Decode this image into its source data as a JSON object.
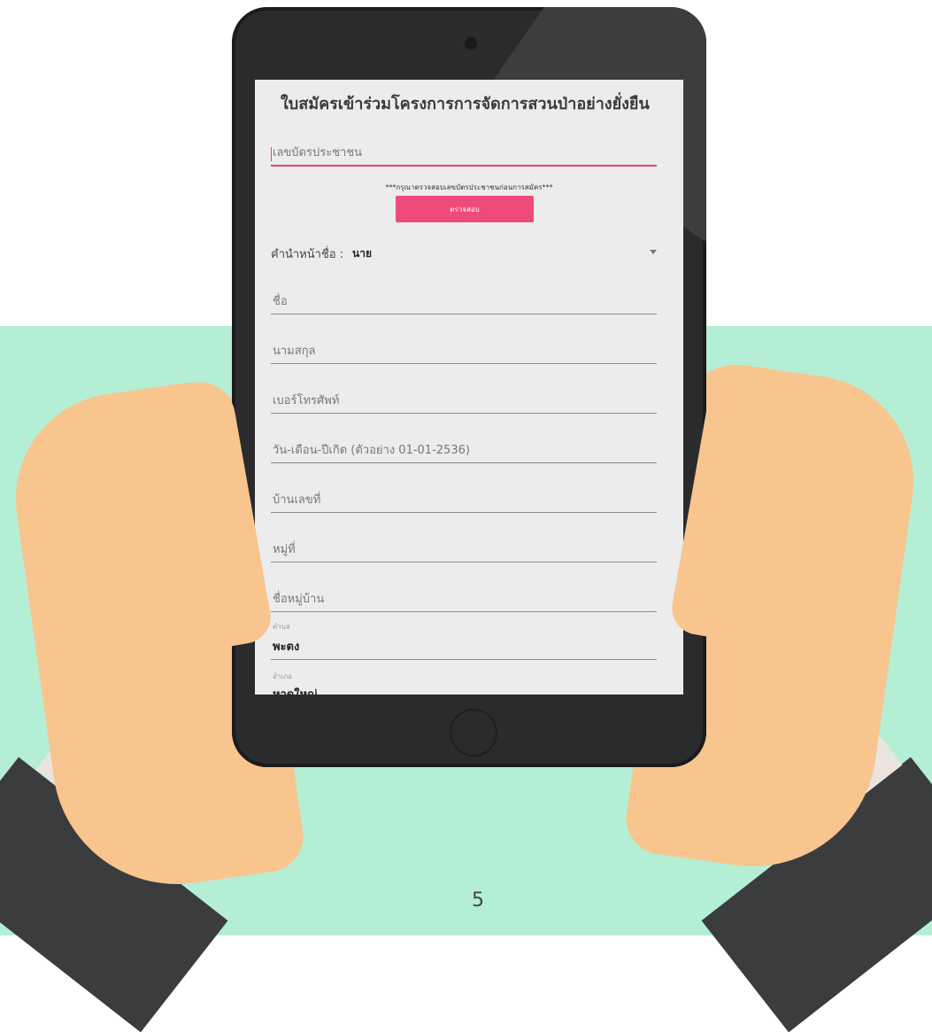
{
  "form": {
    "title": "ใบสมัครเข้าร่วมโครงการการจัดการสวนป่าอย่างยั่งยืน",
    "id_field": {
      "placeholder": "เลขบัตรประชาชน"
    },
    "notice": "***กรุณาตรวจสอบเลขบัตรประชาชนก่อนการสมัคร***",
    "check_button": "ตรวจสอบ",
    "prefix": {
      "label": "คำนำหน้าชื่อ :",
      "value": "นาย"
    },
    "fields": [
      {
        "placeholder": "ชื่อ"
      },
      {
        "placeholder": "นามสกุล"
      },
      {
        "placeholder": "เบอร์โทรศัพท์"
      },
      {
        "placeholder": "วัน-เดือน-ปีเกิด (ตัวอย่าง 01-01-2536)"
      },
      {
        "placeholder": "บ้านเลขที่"
      },
      {
        "placeholder": "หมู่ที่"
      },
      {
        "placeholder": "ชื่อหมู่บ้าน"
      }
    ],
    "subdistrict": {
      "label": "ตำบล",
      "value": "พะตง"
    },
    "district": {
      "label": "อำเภอ",
      "value": "หาดใหญ่"
    }
  },
  "page_number": "5",
  "colors": {
    "accent": "#ef4b7a",
    "background_mint": "#b4efd5",
    "tablet_body": "#2b2b2d",
    "screen_bg": "#ececec",
    "skin": "#f8c58f"
  },
  "icons": {
    "dropdown": "chevron-down-icon"
  }
}
